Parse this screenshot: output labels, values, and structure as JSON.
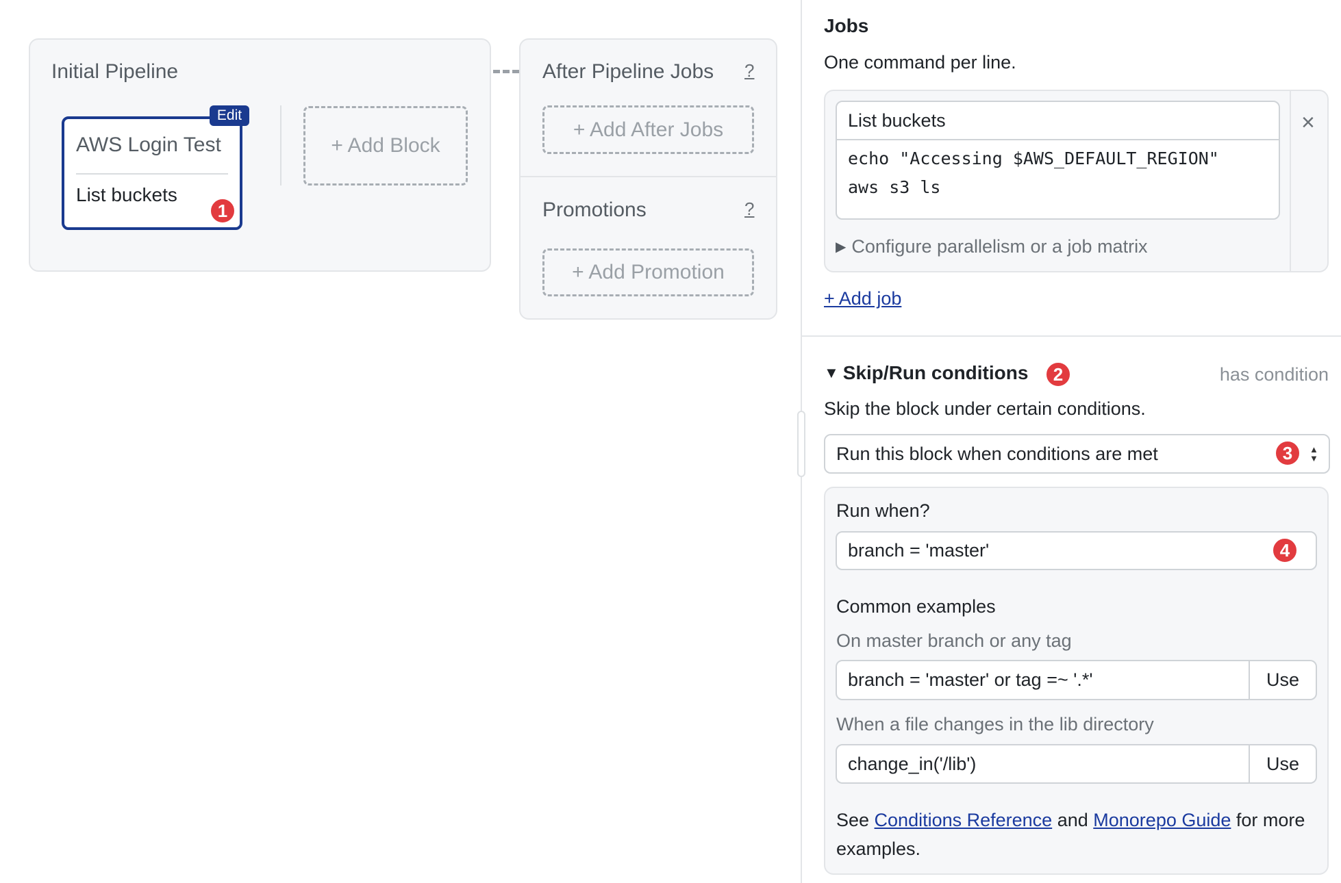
{
  "pipeline": {
    "initial_title": "Initial Pipeline",
    "block": {
      "name": "AWS Login Test",
      "job": "List buckets",
      "edit_label": "Edit",
      "badge": "1"
    },
    "add_block": "+ Add Block",
    "after_jobs_title": "After Pipeline Jobs",
    "after_jobs_help": "?",
    "add_after_jobs": "+ Add After Jobs",
    "promotions_title": "Promotions",
    "promotions_help": "?",
    "add_promotion": "+ Add Promotion"
  },
  "jobs": {
    "title": "Jobs",
    "hint": "One command per line.",
    "job_name": "List buckets",
    "commands": [
      "echo \"Accessing $AWS_DEFAULT_REGION\"",
      "aws s3 ls"
    ],
    "remove_icon": "×",
    "configure": "Configure parallelism or a job matrix",
    "add_job": "+ Add job"
  },
  "conditions": {
    "title": "Skip/Run conditions",
    "badge": "2",
    "status": "has condition",
    "hint": "Skip the block under certain conditions.",
    "select_value": "Run this block when conditions are met",
    "select_badge": "3",
    "run_when_label": "Run when?",
    "run_when_value": "branch = 'master'",
    "run_when_badge": "4",
    "examples_title": "Common examples",
    "examples": [
      {
        "label": "On master branch or any tag",
        "value": "branch = 'master' or tag =~ '.*'",
        "button": "Use"
      },
      {
        "label": "When a file changes in the lib directory",
        "value": "change_in('/lib')",
        "button": "Use"
      }
    ],
    "footer": {
      "see": "See ",
      "link1": "Conditions Reference",
      "and": " and ",
      "link2": "Monorepo Guide",
      "rest": " for more examples."
    }
  },
  "colors": {
    "accent": "#1a3a8f",
    "badge": "#e23b3f",
    "link": "#1a3a9f"
  }
}
